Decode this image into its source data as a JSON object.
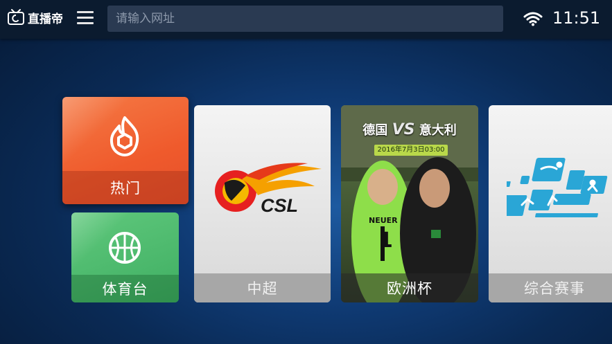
{
  "header": {
    "app_name": "直播帝",
    "search_placeholder": "请输入网址",
    "time": "11:51"
  },
  "tiles": {
    "hot": {
      "label": "热门",
      "color": "#ef5a2c"
    },
    "sports": {
      "label": "体育台",
      "color": "#3fae62"
    },
    "csl": {
      "label": "中超",
      "logo_text": "CSL"
    },
    "euro": {
      "label": "欧洲杯",
      "match_title_left": "德国",
      "match_vs": "VS",
      "match_title_right": "意大利",
      "match_date": "2016年7月3日03:00",
      "jersey_name": "NEUER",
      "jersey_number": "1"
    },
    "multi": {
      "label": "综合赛事"
    }
  }
}
